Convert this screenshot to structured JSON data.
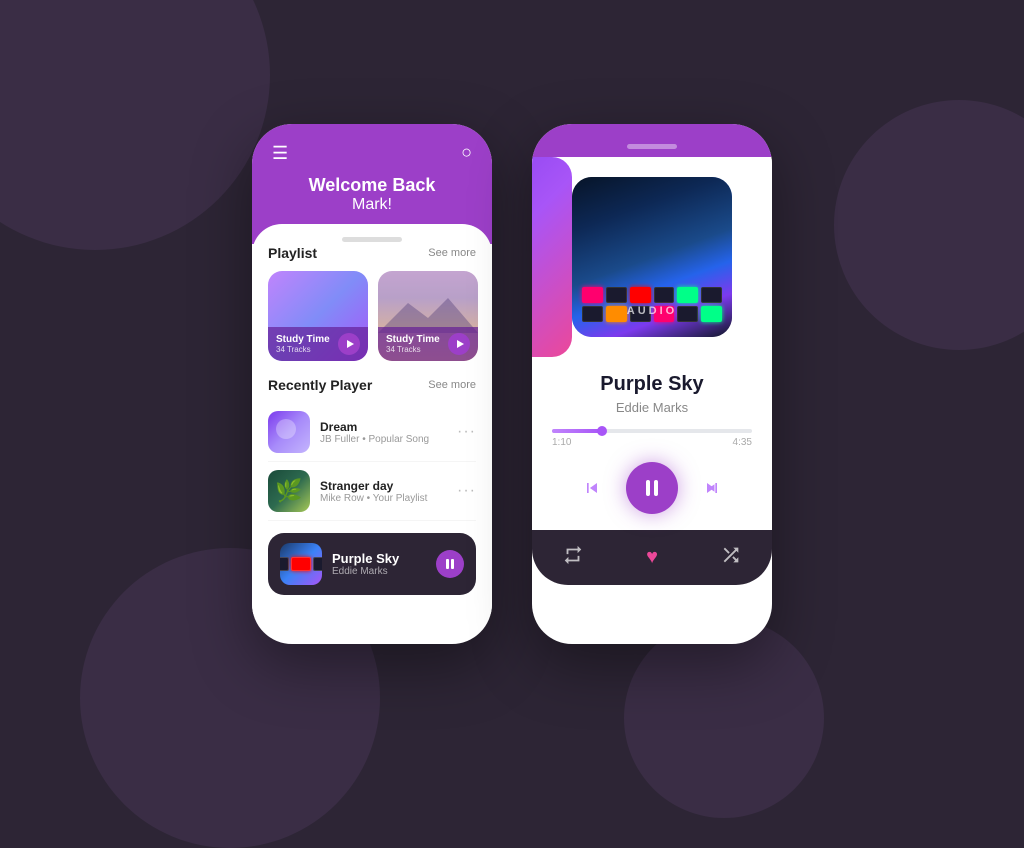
{
  "background": {
    "color": "#2d2535"
  },
  "left_phone": {
    "header": {
      "welcome_line1": "Welcome Back",
      "welcome_line2": "Mark!"
    },
    "playlist_section": {
      "title": "Playlist",
      "see_more": "See more",
      "cards": [
        {
          "title": "Study Time",
          "tracks": "34 Tracks",
          "style": "purple-abstract"
        },
        {
          "title": "Study Time",
          "tracks": "34 Tracks",
          "style": "mountain-sunset"
        }
      ]
    },
    "recently_played": {
      "title": "Recently Player",
      "see_more": "See more",
      "songs": [
        {
          "name": "Dream",
          "meta": "JB Fuller • Popular Song"
        },
        {
          "name": "Stranger day",
          "meta": "Mike Row • Your Playlist"
        }
      ]
    },
    "now_playing": {
      "title": "Purple Sky",
      "artist": "Eddie Marks"
    }
  },
  "right_phone": {
    "track": {
      "title": "Purple Sky",
      "artist": "Eddie Marks"
    },
    "progress": {
      "current": "1:10",
      "total": "4:35",
      "fill_percent": 25
    },
    "controls": {
      "prev": "⏮",
      "pause": "⏸",
      "next": "⏭"
    },
    "actions": {
      "repeat": "↺",
      "heart": "♥",
      "shuffle": "⇄"
    }
  }
}
